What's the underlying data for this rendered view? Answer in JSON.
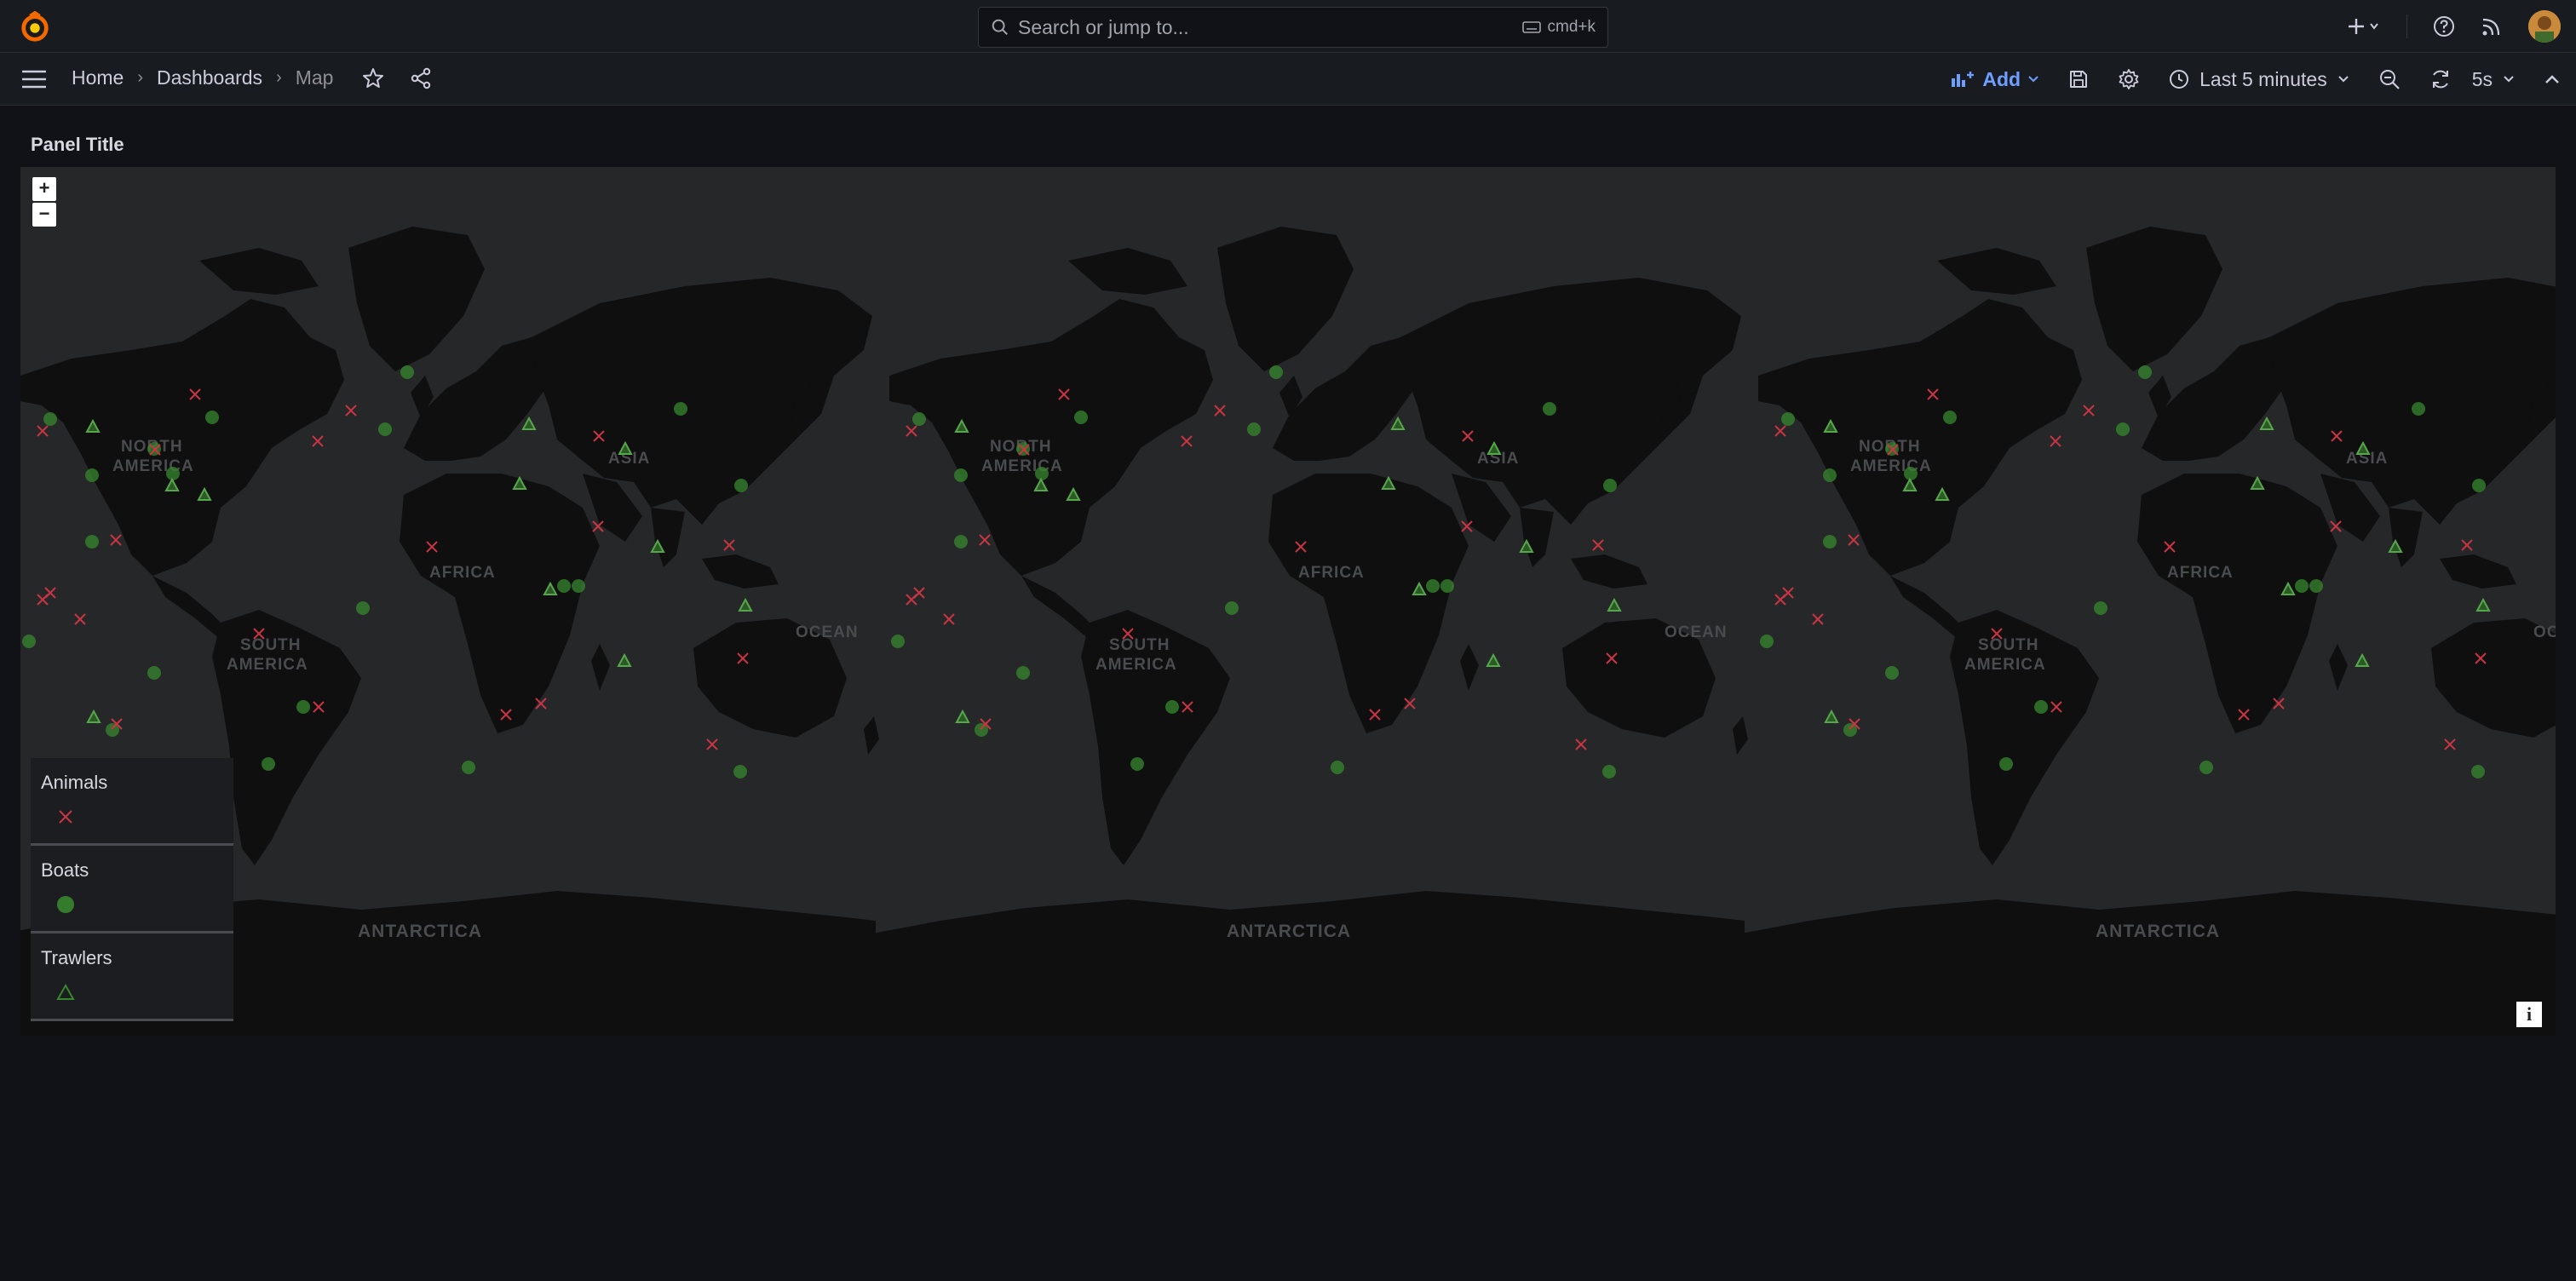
{
  "search": {
    "placeholder": "Search or jump to...",
    "shortcut": "cmd+k"
  },
  "breadcrumb": {
    "home": "Home",
    "dashboards": "Dashboards",
    "current": "Map"
  },
  "toolbar": {
    "add_label": "Add",
    "time_range": "Last 5 minutes",
    "refresh_interval": "5s"
  },
  "panel": {
    "title": "Panel Title"
  },
  "map": {
    "zoom_in": "+",
    "zoom_out": "−",
    "info": "i",
    "labels": {
      "north_america": "NORTH",
      "north_america_2": "AMERICA",
      "south_america": "SOUTH",
      "south_america_2": "AMERICA",
      "africa": "AFRICA",
      "asia": "ASIA",
      "ocean": "OCEAN",
      "antarctica": "ANTARCTICA"
    }
  },
  "legend": {
    "items": [
      {
        "name": "Animals",
        "symbol": "cross-icon",
        "color": "#e02f44"
      },
      {
        "name": "Boats",
        "symbol": "circle-icon",
        "color": "#37872d"
      },
      {
        "name": "Trawlers",
        "symbol": "triangle-icon",
        "color": "#37872d"
      }
    ]
  },
  "colors": {
    "accent": "#6e9fff",
    "animals": "#e02f44",
    "boats": "#56a64b"
  }
}
